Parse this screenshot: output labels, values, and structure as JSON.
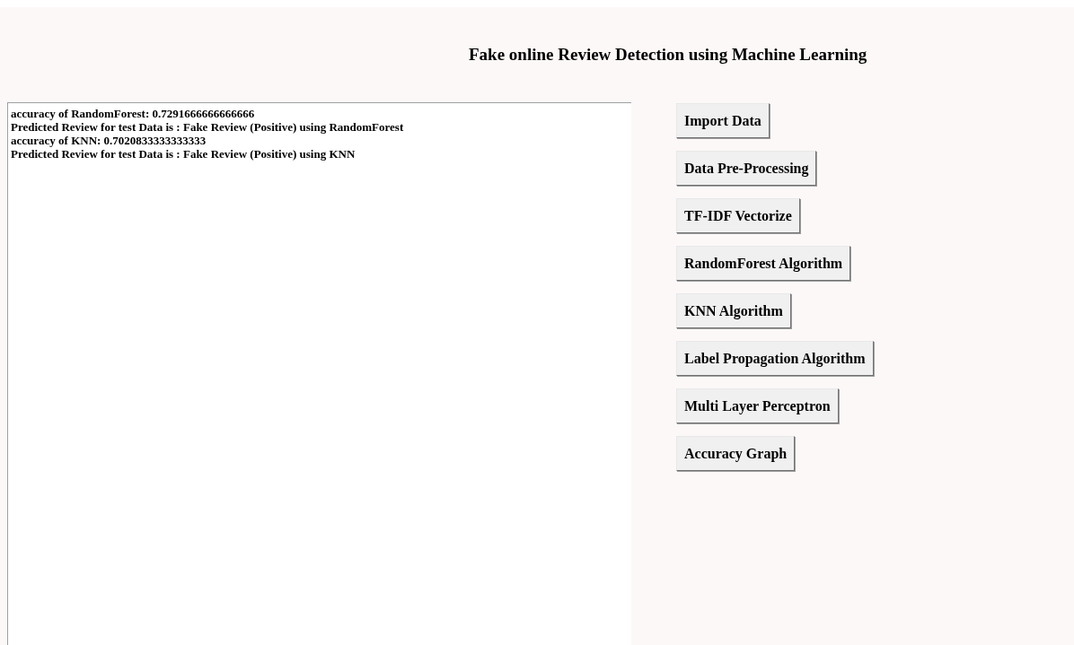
{
  "title": "Fake online Review Detection using Machine Learning",
  "output_lines": [
    "accuracy of RandomForest: 0.7291666666666666",
    "Predicted Review for test Data is : Fake Review (Positive) using RandomForest",
    "accuracy of KNN: 0.7020833333333333",
    "Predicted Review for test Data is : Fake Review (Positive) using KNN"
  ],
  "buttons": [
    "Import Data",
    "Data Pre-Processing",
    "TF-IDF Vectorize",
    "RandomForest Algorithm",
    "KNN Algorithm",
    "Label Propagation Algorithm",
    "Multi Layer Perceptron",
    "Accuracy Graph"
  ]
}
